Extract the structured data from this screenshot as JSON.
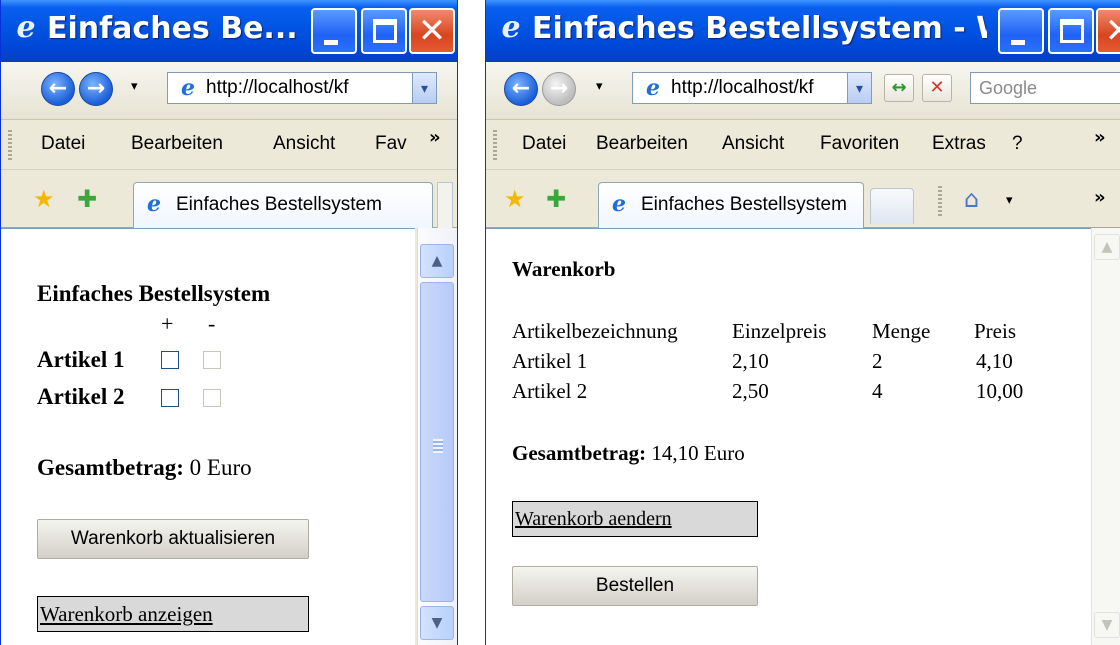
{
  "left": {
    "title": "Einfaches Be...",
    "address": "http://localhost/kf",
    "menu": [
      "Datei",
      "Bearbeiten",
      "Ansicht",
      "Fav"
    ],
    "more_chevron": "»",
    "tab_title": "Einfaches Bestellsystem",
    "heading": "Einfaches Bestellsystem",
    "col_plus": "+",
    "col_minus": "-",
    "items": [
      {
        "label": "Artikel 1"
      },
      {
        "label": "Artikel 2"
      }
    ],
    "total_label": "Gesamtbetrag:",
    "total_value": "0 Euro",
    "update_button": "Warenkorb aktualisieren",
    "show_cart_button": "Warenkorb anzeigen"
  },
  "right": {
    "title": "Einfaches Bestellsystem - Wi...",
    "address": "http://localhost/kf",
    "search_placeholder": "Google",
    "menu": [
      "Datei",
      "Bearbeiten",
      "Ansicht",
      "Favoriten",
      "Extras",
      "?"
    ],
    "more_chevron": "»",
    "tab_title": "Einfaches Bestellsystem",
    "cart_heading": "Warenkorb",
    "columns": [
      "Artikelbezeichnung",
      "Einzelpreis",
      "Menge",
      "Preis"
    ],
    "rows": [
      [
        "Artikel 1",
        "2,10",
        "2",
        "4,10"
      ],
      [
        "Artikel 2",
        "2,50",
        "4",
        "10,00"
      ]
    ],
    "total_label": "Gesamtbetrag:",
    "total_value": "14,10 Euro",
    "change_cart_button": "Warenkorb aendern",
    "order_button": "Bestellen"
  },
  "icons": {
    "ie": "e",
    "back": "←",
    "forward": "→",
    "refresh": "↔",
    "stop": "✕",
    "favorites_star": "★",
    "add_favorite": "✚",
    "home": "⌂",
    "dropdown": "▾",
    "minimize": "minimize-icon",
    "maximize": "maximize-icon",
    "close": "✕",
    "scroll_up": "▲",
    "scroll_down": "▼"
  },
  "colors": {
    "titlebar": "#0054e3",
    "close_button": "#d8451f",
    "window_face": "#ece9d8"
  }
}
